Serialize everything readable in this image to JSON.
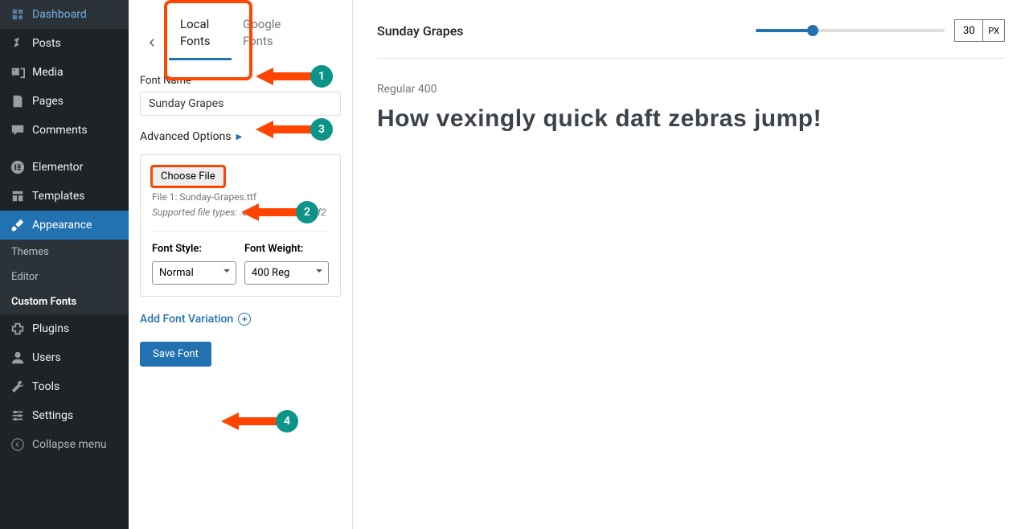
{
  "sidebar": {
    "items": [
      {
        "label": "Dashboard",
        "icon": "dashboard"
      },
      {
        "label": "Posts",
        "icon": "pin"
      },
      {
        "label": "Media",
        "icon": "media"
      },
      {
        "label": "Pages",
        "icon": "page"
      },
      {
        "label": "Comments",
        "icon": "comment"
      },
      {
        "label": "Elementor",
        "icon": "elementor"
      },
      {
        "label": "Templates",
        "icon": "templates"
      },
      {
        "label": "Appearance",
        "icon": "brush"
      },
      {
        "label": "Plugins",
        "icon": "plugin"
      },
      {
        "label": "Users",
        "icon": "user"
      },
      {
        "label": "Tools",
        "icon": "wrench"
      },
      {
        "label": "Settings",
        "icon": "settings"
      },
      {
        "label": "Collapse menu",
        "icon": "collapse"
      }
    ],
    "sub_items": [
      {
        "label": "Themes"
      },
      {
        "label": "Editor"
      },
      {
        "label": "Custom Fonts"
      }
    ]
  },
  "tabs": {
    "local": "Local Fonts",
    "google": "Google Fonts"
  },
  "form": {
    "font_name_label": "Font Name",
    "font_name_value": "Sunday Grapes",
    "advanced_label": "Advanced Options",
    "choose_file_label": "Choose File",
    "file_line": "File 1: Sunday-Grapes.ttf",
    "supported": "Supported file types: .otf, .ttf, .woff, .woff2",
    "font_style_label": "Font Style:",
    "font_style_value": "Normal",
    "font_weight_label": "Font Weight:",
    "font_weight_value": "400 Reg",
    "add_variation": "Add Font Variation",
    "save": "Save Font"
  },
  "preview": {
    "title": "Sunday Grapes",
    "size": "30",
    "unit": "PX",
    "weight_label": "Regular 400",
    "sample": "How vexingly quick daft zebras jump!"
  },
  "annotations": {
    "1": "1",
    "2": "2",
    "3": "3",
    "4": "4"
  }
}
